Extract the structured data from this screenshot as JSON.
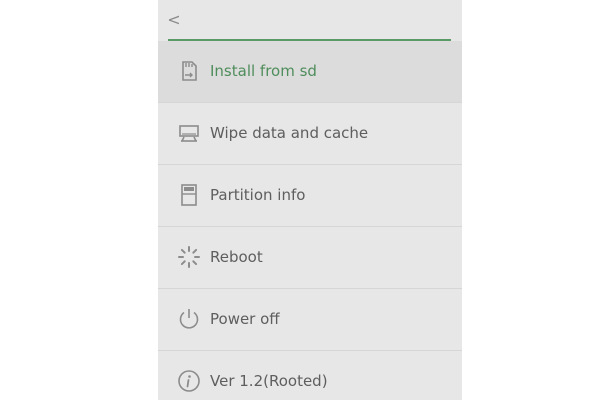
{
  "header": {
    "back_glyph": "<",
    "back_icon": "chevron-left-icon",
    "accent_color": "#5a9a67"
  },
  "menu": {
    "items": [
      {
        "label": "Install from sd",
        "icon": "sd-card-icon",
        "selected": true
      },
      {
        "label": "Wipe data and cache",
        "icon": "wipe-drive-icon",
        "selected": false
      },
      {
        "label": "Partition info",
        "icon": "partition-icon",
        "selected": false
      },
      {
        "label": "Reboot",
        "icon": "reboot-spinner-icon",
        "selected": false
      },
      {
        "label": "Power off",
        "icon": "power-icon",
        "selected": false
      },
      {
        "label": "Ver 1.2(Rooted)",
        "icon": "info-icon",
        "selected": false
      }
    ]
  },
  "colors": {
    "background": "#e7e7e7",
    "selected_row": "#dcdcdc",
    "selected_text": "#4f8d5b",
    "text": "#5e5e5e",
    "icon": "#8c8c8c"
  }
}
